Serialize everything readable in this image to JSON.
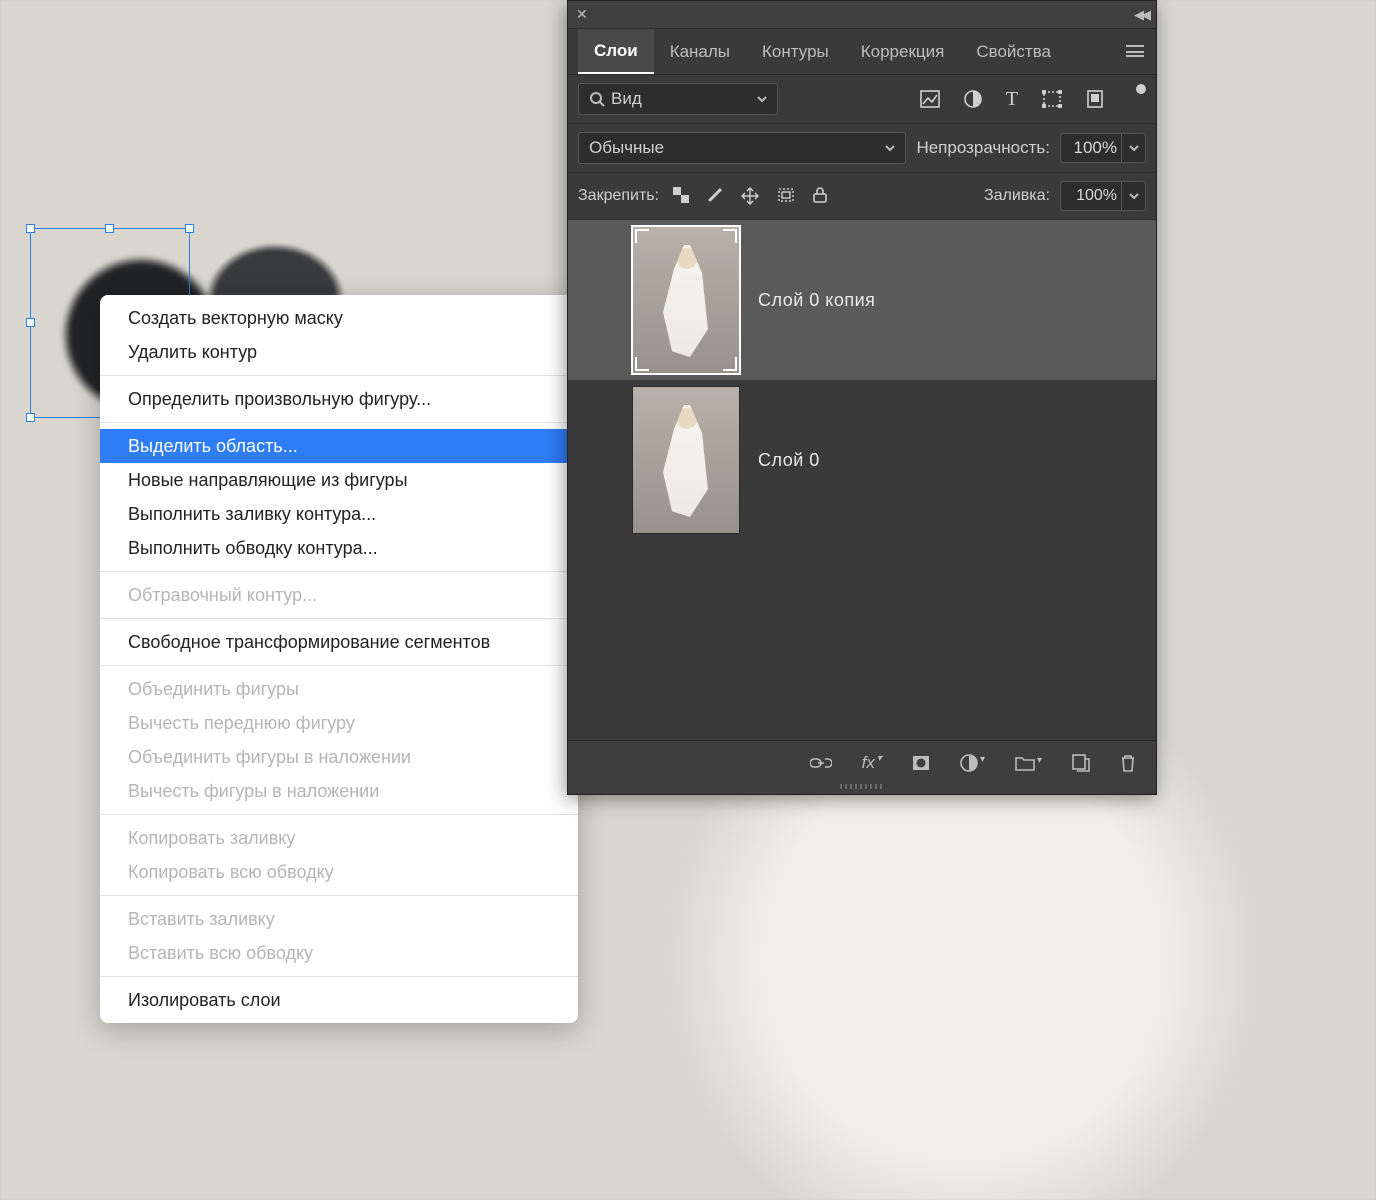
{
  "panel": {
    "tabs": [
      "Слои",
      "Каналы",
      "Контуры",
      "Коррекция",
      "Свойства"
    ],
    "active_tab": 0,
    "search": {
      "label": "Вид",
      "placeholder": "Вид"
    },
    "blend_mode": "Обычные",
    "opacity_label": "Непрозрачность:",
    "opacity_value": "100%",
    "lock_label": "Закрепить:",
    "fill_label": "Заливка:",
    "fill_value": "100%",
    "layers": [
      {
        "name": "Слой 0 копия",
        "selected": true
      },
      {
        "name": "Слой 0",
        "selected": false
      }
    ],
    "icon_names": {
      "image": "image-filter-icon",
      "adjust": "adjust-icon",
      "text": "text-icon",
      "shape": "shape-icon",
      "smart": "smart-object-icon",
      "link": "link-icon",
      "fx": "fx-icon",
      "mask": "mask-icon",
      "adj_layer": "adjustment-layer-icon",
      "group": "group-icon",
      "new": "new-layer-icon",
      "trash": "trash-icon"
    }
  },
  "context_menu": {
    "groups": [
      [
        {
          "label": "Создать векторную маску",
          "disabled": false
        },
        {
          "label": "Удалить контур",
          "disabled": false
        }
      ],
      [
        {
          "label": "Определить произвольную фигуру...",
          "disabled": false
        }
      ],
      [
        {
          "label": "Выделить область...",
          "disabled": false,
          "highlight": true
        },
        {
          "label": "Новые направляющие из фигуры",
          "disabled": false
        },
        {
          "label": "Выполнить заливку контура...",
          "disabled": false
        },
        {
          "label": "Выполнить обводку контура...",
          "disabled": false
        }
      ],
      [
        {
          "label": "Обтравочный контур...",
          "disabled": true
        }
      ],
      [
        {
          "label": "Свободное трансформирование сегментов",
          "disabled": false
        }
      ],
      [
        {
          "label": "Объединить фигуры",
          "disabled": true
        },
        {
          "label": "Вычесть переднюю фигуру",
          "disabled": true
        },
        {
          "label": "Объединить фигуры в наложении",
          "disabled": true
        },
        {
          "label": "Вычесть фигуры в наложении",
          "disabled": true
        }
      ],
      [
        {
          "label": "Копировать заливку",
          "disabled": true
        },
        {
          "label": "Копировать всю обводку",
          "disabled": true
        }
      ],
      [
        {
          "label": "Вставить заливку",
          "disabled": true
        },
        {
          "label": "Вставить всю обводку",
          "disabled": true
        }
      ],
      [
        {
          "label": "Изолировать слои",
          "disabled": false
        }
      ]
    ]
  }
}
